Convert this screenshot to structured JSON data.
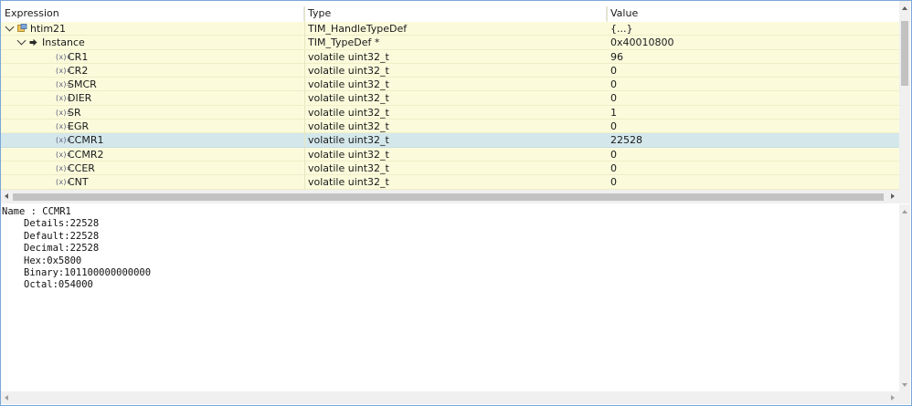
{
  "header": {
    "expression": "Expression",
    "type": "Type",
    "value": "Value"
  },
  "rows": [
    {
      "name": "htim21",
      "type": "TIM_HandleTypeDef",
      "value": "{...}",
      "icon": "struct-icon",
      "expanded": true
    },
    {
      "name": "Instance",
      "type": "TIM_TypeDef *",
      "value": "0x40010800",
      "icon": "pointer-icon",
      "expanded": true
    },
    {
      "name": "CR1",
      "type": "volatile uint32_t",
      "value": "96",
      "icon": "variable-icon"
    },
    {
      "name": "CR2",
      "type": "volatile uint32_t",
      "value": "0",
      "icon": "variable-icon"
    },
    {
      "name": "SMCR",
      "type": "volatile uint32_t",
      "value": "0",
      "icon": "variable-icon"
    },
    {
      "name": "DIER",
      "type": "volatile uint32_t",
      "value": "0",
      "icon": "variable-icon"
    },
    {
      "name": "SR",
      "type": "volatile uint32_t",
      "value": "1",
      "icon": "variable-icon"
    },
    {
      "name": "EGR",
      "type": "volatile uint32_t",
      "value": "0",
      "icon": "variable-icon"
    },
    {
      "name": "CCMR1",
      "type": "volatile uint32_t",
      "value": "22528",
      "icon": "variable-icon",
      "selected": true
    },
    {
      "name": "CCMR2",
      "type": "volatile uint32_t",
      "value": "0",
      "icon": "variable-icon"
    },
    {
      "name": "CCER",
      "type": "volatile uint32_t",
      "value": "0",
      "icon": "variable-icon"
    },
    {
      "name": "CNT",
      "type": "volatile uint32_t",
      "value": "0",
      "icon": "variable-icon"
    }
  ],
  "var_icon_glyph": "(x)=",
  "details": {
    "name_line": "Name : CCMR1",
    "lines": [
      "Details:22528",
      "Default:22528",
      "Decimal:22528",
      "Hex:0x5800",
      "Binary:101100000000000",
      "Octal:054000"
    ]
  },
  "colors": {
    "row_bg": "#fbfbdc",
    "selected_bg": "#d4e8ec",
    "frame_border": "#7aa7d6"
  }
}
